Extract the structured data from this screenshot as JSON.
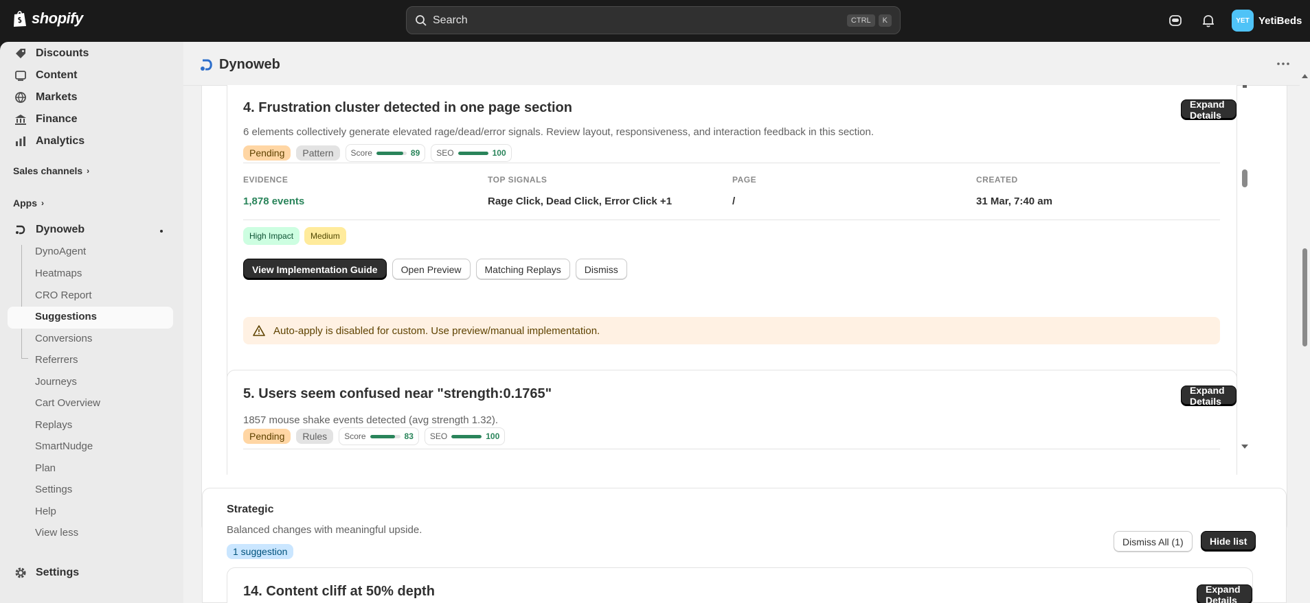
{
  "topbar": {
    "brand": "shopify",
    "search_placeholder": "Search",
    "shortcut_key1": "CTRL",
    "shortcut_key2": "K",
    "user_initials": "YET",
    "user_name": "YetiBeds"
  },
  "sidebar": {
    "top_items": [
      "Discounts",
      "Content",
      "Markets",
      "Finance",
      "Analytics"
    ],
    "sales_channels": "Sales channels",
    "apps": "Apps",
    "app_name": "Dynoweb",
    "sub_items": [
      "DynoAgent",
      "Heatmaps",
      "CRO Report",
      "Suggestions",
      "Conversions",
      "Referrers",
      "Journeys",
      "Cart Overview",
      "Replays",
      "SmartNudge",
      "Plan",
      "Settings",
      "Help",
      "View less"
    ],
    "settings": "Settings"
  },
  "app": {
    "title": "Dynoweb"
  },
  "cards": [
    {
      "title": "4. Frustration cluster detected in one page section",
      "description": "6 elements collectively generate elevated rage/dead/error signals. Review layout, responsiveness, and interaction feedback in this section.",
      "status": "Pending",
      "type": "Pattern",
      "score_label": "Score",
      "score": 89,
      "seo_label": "SEO",
      "seo": 100,
      "expand_label": "Expand Details",
      "evidence_label": "EVIDENCE",
      "evidence": "1,878 events",
      "signals_label": "TOP SIGNALS",
      "signals": "Rage Click, Dead Click, Error Click +1",
      "page_label": "PAGE",
      "page": "/",
      "created_label": "CREATED",
      "created": "31 Mar, 7:40 am",
      "impact": "High Impact",
      "effort": "Medium",
      "actions": [
        "View Implementation Guide",
        "Open Preview",
        "Matching Replays",
        "Dismiss"
      ],
      "warning": "Auto-apply is disabled for custom. Use preview/manual implementation."
    },
    {
      "title": "5. Users seem confused near \"strength:0.1765\"",
      "description": "1857 mouse shake events detected (avg strength 1.32).",
      "status": "Pending",
      "type": "Rules",
      "score_label": "Score",
      "score": 83,
      "seo_label": "SEO",
      "seo": 100,
      "expand_label": "Expand Details"
    }
  ],
  "strategic": {
    "heading": "Strategic",
    "description": "Balanced changes with meaningful upside.",
    "count_badge": "1 suggestion",
    "dismiss_all": "Dismiss All (1)",
    "hide_list": "Hide list",
    "card_title": "14. Content cliff at 50% depth",
    "card_expand": "Expand Details"
  },
  "colors": {
    "topbar": "#1a1a1a",
    "accent_green": "#29845a",
    "pending": "#ffd6a4",
    "warning_bg": "#fff1e3"
  }
}
